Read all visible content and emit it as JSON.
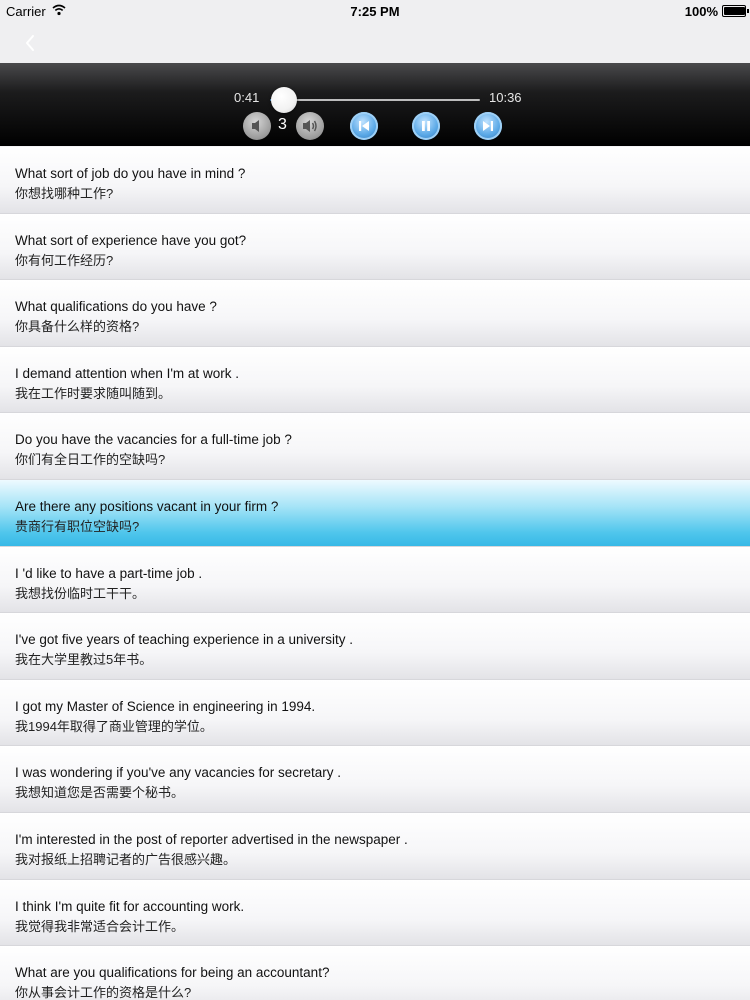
{
  "status_bar": {
    "carrier": "Carrier",
    "time": "7:25 PM",
    "battery_percent": "100%",
    "battery_level": 1.0
  },
  "nav_bar": {
    "back_icon": "chevron-left-icon"
  },
  "player": {
    "elapsed": "0:41",
    "total": "10:36",
    "progress": 0.065,
    "volume_level": "3",
    "icons": {
      "volume_down": "speaker-low-icon",
      "volume_up": "speaker-high-icon",
      "previous": "skip-back-icon",
      "pause": "pause-icon",
      "next": "skip-forward-icon"
    },
    "accent_color": "#3e8fd8"
  },
  "phrases": [
    {
      "en": "What sort of job do you have in mind ?",
      "zh": "你想找哪种工作?"
    },
    {
      "en": "What sort of experience have you got?",
      "zh": "你有何工作经历?"
    },
    {
      "en": "What qualifications do you have ?",
      "zh": "你具备什么样的资格?"
    },
    {
      "en": "I demand attention when I'm at work .",
      "zh": "我在工作时要求随叫随到。"
    },
    {
      "en": "Do you have the vacancies for a full-time job ?",
      "zh": "你们有全日工作的空缺吗?"
    },
    {
      "en": "Are there any positions vacant in  your firm ?",
      "zh": "贵商行有职位空缺吗?",
      "selected": true
    },
    {
      "en": "I 'd like to have a part-time  job .",
      "zh": "我想找份临时工干干。"
    },
    {
      "en": "I've got five years of teaching experience in a university .",
      "zh": "我在大学里教过5年书。"
    },
    {
      "en": "I got my Master of Science in engineering in 1994.",
      "zh": "我1994年取得了商业管理的学位。"
    },
    {
      "en": "I was  wondering if you've any vacancies for secretary .",
      "zh": "我想知道您是否需要个秘书。"
    },
    {
      "en": "I'm interested in the post of reporter advertised in the newspaper .",
      "zh": "我对报纸上招聘记者的广告很感兴趣。"
    },
    {
      "en": "I think I'm quite fit for accounting work.",
      "zh": "我觉得我非常适合会计工作。"
    },
    {
      "en": "What are you qualifications for being an accountant?",
      "zh": "你从事会计工作的资格是什么?"
    }
  ]
}
